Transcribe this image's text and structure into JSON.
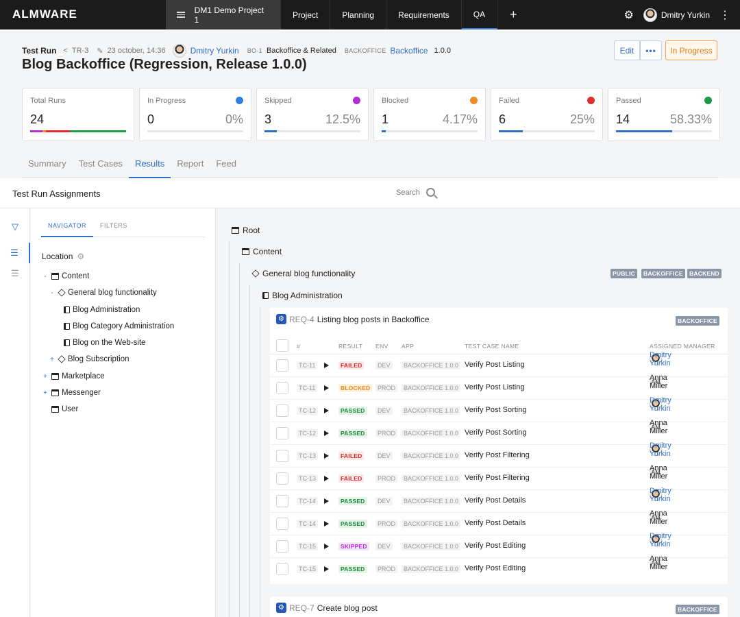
{
  "app": {
    "logo": "ALMWARE",
    "project": "DM1 Demo Project 1",
    "tabs": [
      "Project",
      "Planning",
      "Requirements",
      "QA"
    ],
    "plus": "+",
    "user": "Dmitry Yurkin",
    "accent": "#2f6fc9"
  },
  "header": {
    "label": "Test Run",
    "run_id": "TR-3",
    "date": "23 october, 14:36",
    "author": "Dmitry Yurkin",
    "bo_tag": "BO-1",
    "bo_name": "Backoffice & Related",
    "app_tag": "BACKOFFICE",
    "app_name": "Backoffice",
    "version": "1.0.0",
    "title": "Blog Backoffice (Regression, Release 1.0.0)",
    "edit_label": "Edit",
    "more_label": "•••",
    "status_label": "In Progress"
  },
  "stats": [
    {
      "label": "Total Runs",
      "value": "24",
      "pct": ""
    },
    {
      "label": "In Progress",
      "value": "0",
      "pct": "0%",
      "color": "#2f7fe0",
      "fraction": 0
    },
    {
      "label": "Skipped",
      "value": "3",
      "pct": "12.5%",
      "color": "#b02fd6",
      "fraction": 0.125
    },
    {
      "label": "Blocked",
      "value": "1",
      "pct": "4.17%",
      "color": "#f08a24",
      "fraction": 0.0417
    },
    {
      "label": "Failed",
      "value": "6",
      "pct": "25%",
      "color": "#e02d2d",
      "fraction": 0.25
    },
    {
      "label": "Passed",
      "value": "14",
      "pct": "58.33%",
      "color": "#1e9a46",
      "fraction": 0.5833
    }
  ],
  "subtabs": [
    "Summary",
    "Test Cases",
    "Results",
    "Report",
    "Feed"
  ],
  "assignments": {
    "title": "Test Run Assignments",
    "search_placeholder": "Search"
  },
  "navigator": {
    "tabs": [
      "NAVIGATOR",
      "FILTERS"
    ],
    "location_label": "Location",
    "tree": [
      {
        "label": "Content",
        "toggle": "-"
      },
      {
        "label": "General blog functionality",
        "toggle": "-"
      },
      {
        "label": "Blog Administration",
        "toggle": ""
      },
      {
        "label": "Blog Category Administration",
        "toggle": ""
      },
      {
        "label": "Blog on the Web-site",
        "toggle": ""
      },
      {
        "label": "Blog Subscription",
        "toggle": "+"
      },
      {
        "label": "Marketplace",
        "toggle": "+"
      },
      {
        "label": "Messenger",
        "toggle": "+"
      },
      {
        "label": "User",
        "toggle": ""
      }
    ]
  },
  "main": {
    "root": "Root",
    "content": "Content",
    "general": "General blog functionality",
    "general_tags": [
      "PUBLIC",
      "BACKOFFICE",
      "BACKEND"
    ],
    "blog_admin": "Blog Administration",
    "req1": {
      "id": "REQ-4",
      "name": "Listing blog posts in Backoffice",
      "tag": "BACKOFFICE"
    },
    "req2": {
      "id": "REQ-7",
      "name": "Create blog post",
      "tag": "BACKOFFICE"
    },
    "columns": [
      "#",
      "RESULT",
      "ENV",
      "APP",
      "TEST CASE NAME",
      "ASSIGNED MANAGER"
    ],
    "rows": [
      {
        "tc": "TC-11",
        "result": "FAILED",
        "env": "DEV",
        "app": "BACKOFFICE 1.0.0",
        "name": "Verify Post Listing",
        "manager": "Dmitry Yurkin"
      },
      {
        "tc": "TC-11",
        "result": "BLOCKED",
        "env": "PROD",
        "app": "BACKOFFICE 1.0.0",
        "name": "Verify Post Listing",
        "manager": "Anna Miller"
      },
      {
        "tc": "TC-12",
        "result": "PASSED",
        "env": "DEV",
        "app": "BACKOFFICE 1.0.0",
        "name": "Verify Post Sorting",
        "manager": "Dmitry Yurkin"
      },
      {
        "tc": "TC-12",
        "result": "PASSED",
        "env": "PROD",
        "app": "BACKOFFICE 1.0.0",
        "name": "Verify Post Sorting",
        "manager": "Anna Miller"
      },
      {
        "tc": "TC-13",
        "result": "FAILED",
        "env": "DEV",
        "app": "BACKOFFICE 1.0.0",
        "name": "Verify Post Filtering",
        "manager": "Dmitry Yurkin"
      },
      {
        "tc": "TC-13",
        "result": "FAILED",
        "env": "PROD",
        "app": "BACKOFFICE 1.0.0",
        "name": "Verify Post Filtering",
        "manager": "Anna Miller"
      },
      {
        "tc": "TC-14",
        "result": "PASSED",
        "env": "DEV",
        "app": "BACKOFFICE 1.0.0",
        "name": "Verify Post Details",
        "manager": "Dmitry Yurkin"
      },
      {
        "tc": "TC-14",
        "result": "PASSED",
        "env": "PROD",
        "app": "BACKOFFICE 1.0.0",
        "name": "Verify Post Details",
        "manager": "Anna Miller"
      },
      {
        "tc": "TC-15",
        "result": "SKIPPED",
        "env": "DEV",
        "app": "BACKOFFICE 1.0.0",
        "name": "Verify Post Editing",
        "manager": "Dmitry Yurkin"
      },
      {
        "tc": "TC-15",
        "result": "PASSED",
        "env": "PROD",
        "app": "BACKOFFICE 1.0.0",
        "name": "Verify Post Editing",
        "manager": "Anna Miller"
      }
    ],
    "am_initials": "AM"
  }
}
